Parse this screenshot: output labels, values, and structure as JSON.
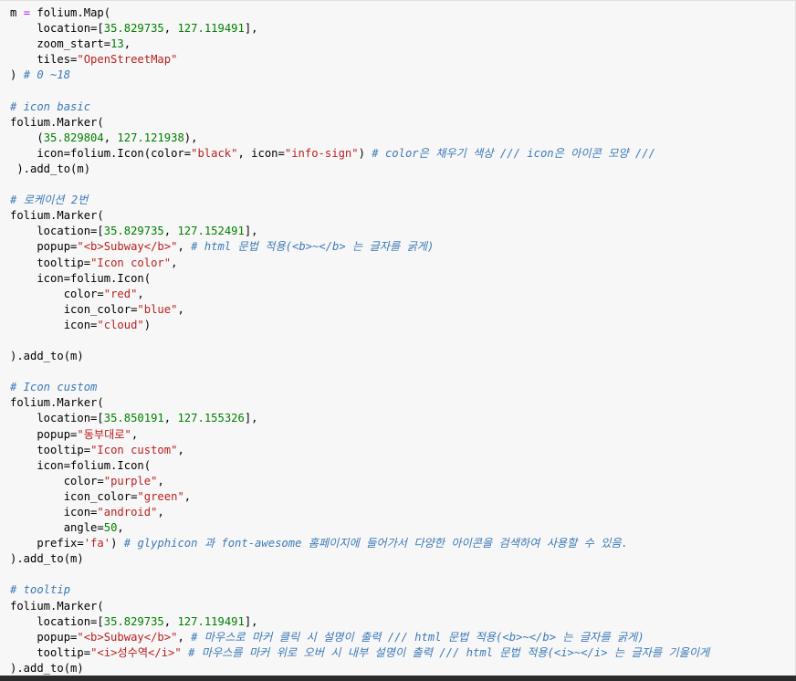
{
  "lines": [
    [
      [
        "t",
        "m "
      ],
      [
        "o",
        "="
      ],
      [
        "t",
        " folium.Map("
      ]
    ],
    [
      [
        "t",
        "    location=["
      ],
      [
        "n",
        "35.829735"
      ],
      [
        "t",
        ", "
      ],
      [
        "n",
        "127.119491"
      ],
      [
        "t",
        "],"
      ]
    ],
    [
      [
        "t",
        "    zoom_start="
      ],
      [
        "n",
        "13"
      ],
      [
        "t",
        ","
      ]
    ],
    [
      [
        "t",
        "    tiles="
      ],
      [
        "s",
        "\"OpenStreetMap\""
      ]
    ],
    [
      [
        "t",
        ") "
      ],
      [
        "c",
        "# 0 ~18"
      ]
    ],
    [],
    [
      [
        "c",
        "# icon basic"
      ]
    ],
    [
      [
        "t",
        "folium.Marker("
      ]
    ],
    [
      [
        "t",
        "    ("
      ],
      [
        "n",
        "35.829804"
      ],
      [
        "t",
        ", "
      ],
      [
        "n",
        "127.121938"
      ],
      [
        "t",
        "),"
      ]
    ],
    [
      [
        "t",
        "    icon=folium.Icon(color="
      ],
      [
        "s",
        "\"black\""
      ],
      [
        "t",
        ", icon="
      ],
      [
        "s",
        "\"info-sign\""
      ],
      [
        "t",
        ") "
      ],
      [
        "c",
        "# color은 채우기 색상 /// icon은 아이콘 모양 ///"
      ]
    ],
    [
      [
        "t",
        " ).add_to(m)"
      ]
    ],
    [],
    [
      [
        "c",
        "# 로케이션 2번"
      ]
    ],
    [
      [
        "t",
        "folium.Marker("
      ]
    ],
    [
      [
        "t",
        "    location=["
      ],
      [
        "n",
        "35.829735"
      ],
      [
        "t",
        ", "
      ],
      [
        "n",
        "127.152491"
      ],
      [
        "t",
        "],"
      ]
    ],
    [
      [
        "t",
        "    popup="
      ],
      [
        "s",
        "\"<b>Subway</b>\""
      ],
      [
        "t",
        ", "
      ],
      [
        "c",
        "# html 문법 적용(<b>~</b> 는 글자를 굵게)"
      ]
    ],
    [
      [
        "t",
        "    tooltip="
      ],
      [
        "s",
        "\"Icon color\""
      ],
      [
        "t",
        ","
      ]
    ],
    [
      [
        "t",
        "    icon=folium.Icon("
      ]
    ],
    [
      [
        "t",
        "        color="
      ],
      [
        "s",
        "\"red\""
      ],
      [
        "t",
        ","
      ]
    ],
    [
      [
        "t",
        "        icon_color="
      ],
      [
        "s",
        "\"blue\""
      ],
      [
        "t",
        ","
      ]
    ],
    [
      [
        "t",
        "        icon="
      ],
      [
        "s",
        "\"cloud\""
      ],
      [
        "t",
        ")"
      ]
    ],
    [],
    [
      [
        "t",
        ").add_to(m)"
      ]
    ],
    [],
    [
      [
        "c",
        "# Icon custom"
      ]
    ],
    [
      [
        "t",
        "folium.Marker("
      ]
    ],
    [
      [
        "t",
        "    location=["
      ],
      [
        "n",
        "35.850191"
      ],
      [
        "t",
        ", "
      ],
      [
        "n",
        "127.155326"
      ],
      [
        "t",
        "],"
      ]
    ],
    [
      [
        "t",
        "    popup="
      ],
      [
        "s",
        "\"동부대로\""
      ],
      [
        "t",
        ","
      ]
    ],
    [
      [
        "t",
        "    tooltip="
      ],
      [
        "s",
        "\"Icon custom\""
      ],
      [
        "t",
        ","
      ]
    ],
    [
      [
        "t",
        "    icon=folium.Icon("
      ]
    ],
    [
      [
        "t",
        "        color="
      ],
      [
        "s",
        "\"purple\""
      ],
      [
        "t",
        ","
      ]
    ],
    [
      [
        "t",
        "        icon_color="
      ],
      [
        "s",
        "\"green\""
      ],
      [
        "t",
        ","
      ]
    ],
    [
      [
        "t",
        "        icon="
      ],
      [
        "s",
        "\"android\""
      ],
      [
        "t",
        ","
      ]
    ],
    [
      [
        "t",
        "        angle="
      ],
      [
        "n",
        "50"
      ],
      [
        "t",
        ","
      ]
    ],
    [
      [
        "t",
        "    prefix="
      ],
      [
        "s",
        "'fa'"
      ],
      [
        "t",
        ") "
      ],
      [
        "c",
        "# glyphicon 과 font-awesome 홈페이지에 들어가서 다양한 아이콘을 검색하여 사용할 수 있음."
      ]
    ],
    [
      [
        "t",
        ").add_to(m)"
      ]
    ],
    [],
    [
      [
        "c",
        "# tooltip"
      ]
    ],
    [
      [
        "t",
        "folium.Marker("
      ]
    ],
    [
      [
        "t",
        "    location=["
      ],
      [
        "n",
        "35.829735"
      ],
      [
        "t",
        ", "
      ],
      [
        "n",
        "127.119491"
      ],
      [
        "t",
        "],"
      ]
    ],
    [
      [
        "t",
        "    popup="
      ],
      [
        "s",
        "\"<b>Subway</b>\""
      ],
      [
        "t",
        ", "
      ],
      [
        "c",
        "# 마우스로 마커 클릭 시 설명이 출력 /// html 문법 적용(<b>~</b> 는 글자를 굵게)"
      ]
    ],
    [
      [
        "t",
        "    tooltip="
      ],
      [
        "s",
        "\"<i>성수역</i>\""
      ],
      [
        "t",
        " "
      ],
      [
        "c",
        "# 마우스를 마커 위로 오버 시 내부 설명이 출력 /// html 문법 적용(<i>~</i> 는 글자를 기울이게"
      ]
    ],
    [
      [
        "t",
        ").add_to(m)"
      ]
    ]
  ]
}
